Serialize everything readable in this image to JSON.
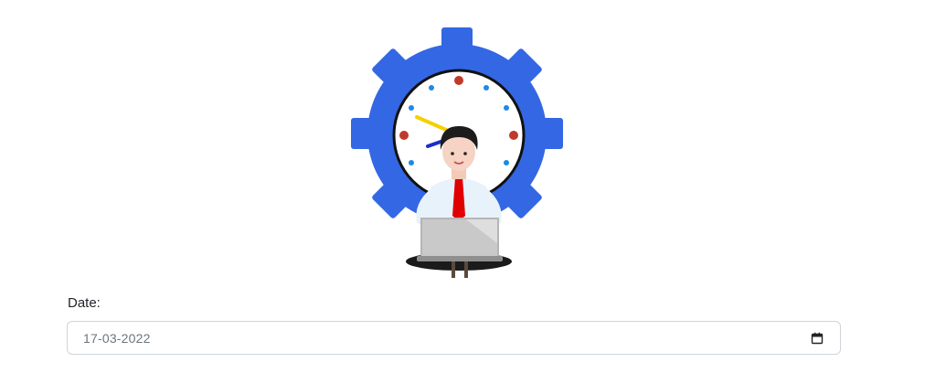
{
  "form": {
    "date_label": "Date:",
    "date_value": "17-03-2022"
  },
  "icons": {
    "calendar": "calendar-icon",
    "illustration": "businessman-at-laptop-with-gear-clock"
  },
  "colors": {
    "gear": "#3467e3",
    "clock_face": "#ffffff",
    "hour_dot": "#c0392b",
    "minute_dot": "#1e88e5",
    "tie": "#e00000",
    "laptop": "#b5b5b5",
    "field_border": "#ced4da",
    "label_text": "#212529",
    "value_text": "#6c757d"
  }
}
